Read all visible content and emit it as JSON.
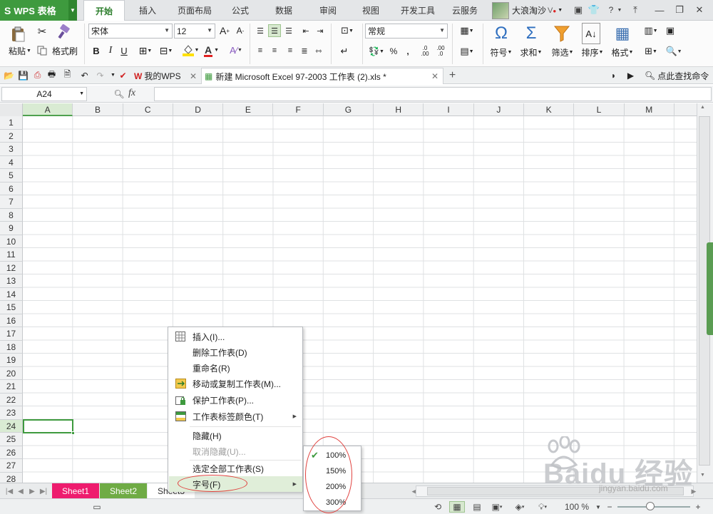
{
  "app": {
    "name": "WPS 表格",
    "logo_glyph": "S"
  },
  "menu_tabs": [
    "开始",
    "插入",
    "页面布局",
    "公式",
    "数据",
    "审阅",
    "视图",
    "开发工具",
    "云服务"
  ],
  "active_tab": "开始",
  "user": {
    "name": "大浪淘沙"
  },
  "ribbon": {
    "paste": "粘贴",
    "format_painter": "格式刷",
    "font_name": "宋体",
    "font_size": "12",
    "bold": "B",
    "italic": "I",
    "underline": "U",
    "number_format": "常规",
    "percent": "%",
    "comma": ",",
    "symbol": "符号",
    "sum": "求和",
    "filter": "筛选",
    "sort": "排序",
    "format": "格式"
  },
  "doc_tabs": [
    {
      "label": "我的WPS"
    },
    {
      "label": "新建 Microsoft Excel 97-2003 工作表 (2).xls *"
    }
  ],
  "search_command": "点此查找命令",
  "formula_bar": {
    "cell_ref": "A24",
    "fx_label": "fx",
    "value": ""
  },
  "columns": [
    "A",
    "B",
    "C",
    "D",
    "E",
    "F",
    "G",
    "H",
    "I",
    "J",
    "K",
    "L",
    "M"
  ],
  "rows": [
    "1",
    "2",
    "3",
    "4",
    "5",
    "6",
    "7",
    "8",
    "9",
    "10",
    "11",
    "12",
    "13",
    "14",
    "15",
    "16",
    "17",
    "18",
    "19",
    "20",
    "21",
    "22",
    "23",
    "24",
    "25",
    "26",
    "27",
    "28"
  ],
  "selected_cell": {
    "column": "A",
    "row": "24"
  },
  "context_menu": {
    "items": [
      {
        "label": "插入(I)...",
        "icon": "insert-table-icon"
      },
      {
        "label": "删除工作表(D)"
      },
      {
        "label": "重命名(R)"
      },
      {
        "label": "移动或复制工作表(M)...",
        "icon": "move-copy-icon"
      },
      {
        "label": "保护工作表(P)...",
        "icon": "protect-sheet-icon"
      },
      {
        "label": "工作表标签颜色(T)",
        "icon": "tab-color-icon",
        "submenu": true
      },
      {
        "label": "隐藏(H)"
      },
      {
        "label": "取消隐藏(U)...",
        "disabled": true
      },
      {
        "label": "选定全部工作表(S)"
      },
      {
        "label": "字号(F)",
        "submenu": true,
        "highlighted": true
      }
    ]
  },
  "font_size_submenu": {
    "options": [
      "100%",
      "150%",
      "200%",
      "300%"
    ],
    "checked": "100%"
  },
  "sheets": [
    {
      "label": "Sheet1",
      "color": "#ee1c6e"
    },
    {
      "label": "Sheet2",
      "color": "#6fab45"
    },
    {
      "label": "Sheet3",
      "color": ""
    }
  ],
  "status": {
    "zoom": "100 %"
  },
  "watermark": {
    "text": "Baidu 经验",
    "url": "jingyan.baidu.com"
  },
  "colors": {
    "accent": "#3e9a3e",
    "annotation": "#e0403d"
  }
}
